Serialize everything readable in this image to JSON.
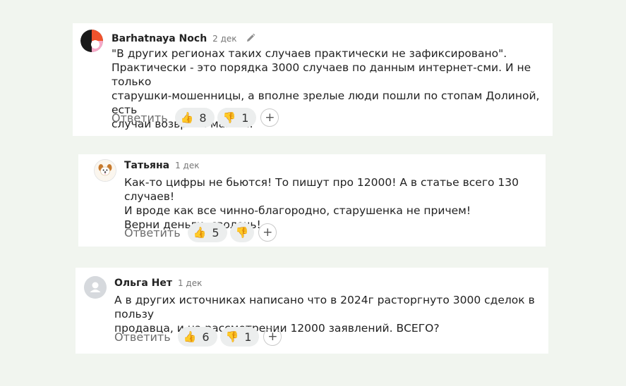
{
  "comments": [
    {
      "author": "Barhatnaya Noch",
      "date": "2 дек",
      "icons": {
        "avatar": "abstract-avatar",
        "edit": "pencil-icon"
      },
      "lines": [
        "\"В других регионах таких случаев практически не зафиксировано\".",
        "Практически - это порядка 3000 случаев по данным интернет-сми. И не только",
        "старушки-мошенницы, а вполне зрелые люди пошли по стопам Долиной, есть",
        "случаи возврата машин."
      ],
      "reply": "Ответить",
      "likes": "8",
      "dislikes": "1",
      "like_emoji": "👍",
      "dislike_emoji": "👎"
    },
    {
      "author": "Татьяна",
      "date": "1 дек",
      "icons": {
        "avatar": "dog-avatar"
      },
      "lines": [
        "Как-то цифры не бьются! То пишут про 12000! А в статье всего 130 случаев!",
        "И вроде как все чинно-благородно, старушенка не причем!",
        "Верни деньги, сволочь!"
      ],
      "reply": "Ответить",
      "likes": "5",
      "like_emoji": "👍",
      "dislike_emoji": "👎"
    },
    {
      "author": "Ольга Нет",
      "date": "1 дек",
      "icons": {
        "avatar": "default-user-avatar"
      },
      "lines": [
        "А в других источниках написано что в 2024г расторгнуто 3000 сделок в пользу",
        "продавца, и на рассмотрении 12000 заявлений. ВСЕГО?"
      ],
      "reply": "Ответить",
      "likes": "6",
      "dislikes": "1",
      "like_emoji": "👍",
      "dislike_emoji": "👎"
    }
  ],
  "add_reaction_symbol": "+",
  "colors": {
    "background": "#f1f5ef",
    "card": "#ffffff",
    "pill": "#eceeee"
  }
}
